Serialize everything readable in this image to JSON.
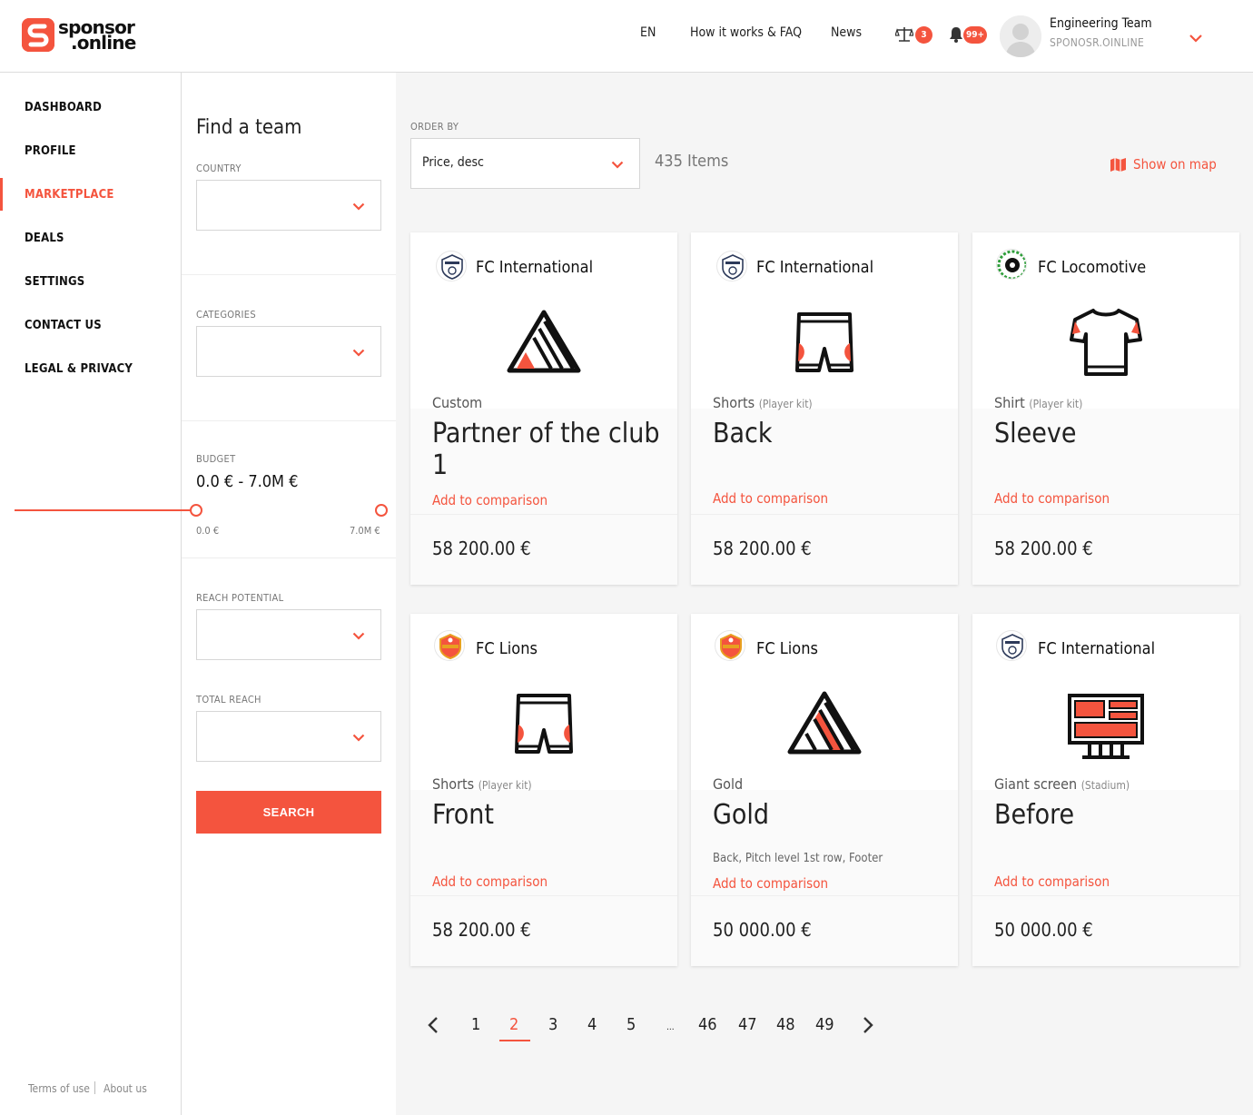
{
  "brand": {
    "name_line1": "sponsor",
    "name_line2": ".online"
  },
  "header": {
    "language": "EN",
    "faq": "How it works & FAQ",
    "news": "News",
    "compare_count": "3",
    "notifications_count": "99+",
    "user_name": "Engineering Team",
    "user_org": "SPONOSR.OINLINE"
  },
  "sidebar": {
    "items": [
      {
        "label": "DASHBOARD"
      },
      {
        "label": "PROFILE"
      },
      {
        "label": "MARKETPLACE"
      },
      {
        "label": "DEALS"
      },
      {
        "label": "SETTINGS"
      },
      {
        "label": "CONTACT US"
      },
      {
        "label": "LEGAL & PRIVACY"
      }
    ],
    "active": "MARKETPLACE",
    "footer": {
      "terms": "Terms of use",
      "about": "About us"
    }
  },
  "filters": {
    "title": "Find a team",
    "country_label": "COUNTRY",
    "categories_label": "CATEGORIES",
    "budget_label": "BUDGET",
    "budget_value": "0.0 € - 7.0M €",
    "budget_min": "0.0 €",
    "budget_max": "7.0M €",
    "reach_potential_label": "REACH POTENTIAL",
    "total_reach_label": "TOTAL REACH",
    "search_button": "SEARCH"
  },
  "results": {
    "order_label": "ORDER BY",
    "order_value": "Price, desc",
    "items_count": "435 Items",
    "map_link": "Show on map",
    "compare_label": "Add to comparison"
  },
  "cards": [
    {
      "team": "FC International",
      "category": "Custom",
      "subcategory": "",
      "title": "Partner of the club 1",
      "description": "",
      "price": "58 200.00 €",
      "icon": "triangle-icon",
      "logo": "international-logo"
    },
    {
      "team": "FC International",
      "category": "Shorts",
      "subcategory": "(Player kit)",
      "title": "Back",
      "description": "",
      "price": "58 200.00 €",
      "icon": "shorts-icon",
      "logo": "international-logo"
    },
    {
      "team": "FC Locomotive",
      "category": "Shirt",
      "subcategory": "(Player kit)",
      "title": "Sleeve",
      "description": "",
      "price": "58 200.00 €",
      "icon": "shirt-icon",
      "logo": "locomotive-logo"
    },
    {
      "team": "FC Lions",
      "category": "Shorts",
      "subcategory": "(Player kit)",
      "title": "Front",
      "description": "",
      "price": "58 200.00 €",
      "icon": "shorts-icon",
      "logo": "lions-logo"
    },
    {
      "team": "FC Lions",
      "category": "Gold",
      "subcategory": "",
      "title": "Gold",
      "description": "Back, Pitch level 1st row, Footer",
      "price": "50 000.00 €",
      "icon": "triangle-icon",
      "logo": "lions-logo"
    },
    {
      "team": "FC International",
      "category": "Giant screen",
      "subcategory": "(Stadium)",
      "title": "Before",
      "description": "",
      "price": "50 000.00 €",
      "icon": "giant-screen-icon",
      "logo": "international-logo"
    }
  ],
  "pagination": {
    "pages": [
      "1",
      "2",
      "3",
      "4",
      "5",
      "...",
      "46",
      "47",
      "48",
      "49"
    ],
    "current": "2"
  },
  "colors": {
    "accent": "#f4543e",
    "background": "#f5f5f5",
    "text": "#222222"
  }
}
